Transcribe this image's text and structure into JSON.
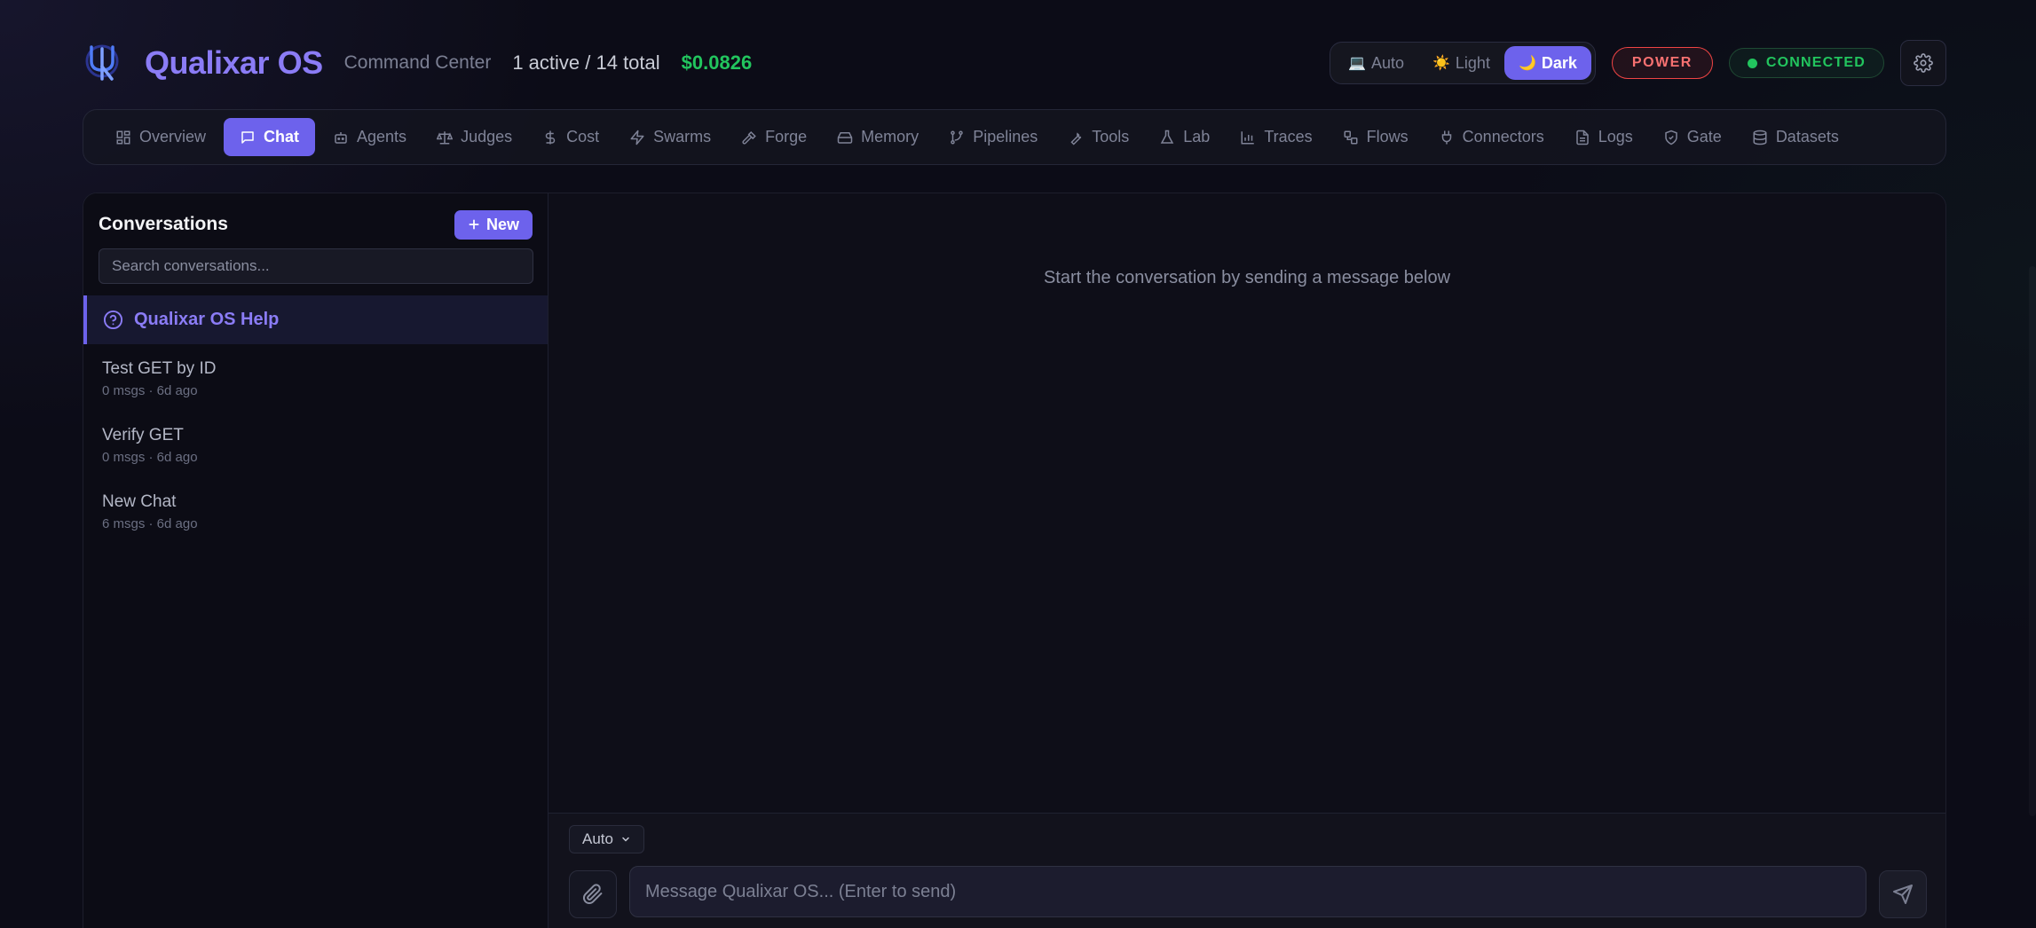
{
  "header": {
    "app_title": "Qualixar OS",
    "subtitle": "Command Center",
    "agent_count": "1 active / 14 total",
    "cost": "$0.0826",
    "theme": {
      "options": [
        {
          "emoji": "💻",
          "label": "Auto"
        },
        {
          "emoji": "☀️",
          "label": "Light"
        },
        {
          "emoji": "🌙",
          "label": "Dark"
        }
      ],
      "selected": "Dark"
    },
    "power_badge": "POWER",
    "connection_badge": "CONNECTED"
  },
  "nav": {
    "active": "Chat",
    "items": [
      {
        "label": "Overview",
        "icon": "grid-icon"
      },
      {
        "label": "Chat",
        "icon": "chat-bubble-icon"
      },
      {
        "label": "Agents",
        "icon": "bot-icon"
      },
      {
        "label": "Judges",
        "icon": "scale-icon"
      },
      {
        "label": "Cost",
        "icon": "dollar-icon"
      },
      {
        "label": "Swarms",
        "icon": "bolt-icon"
      },
      {
        "label": "Forge",
        "icon": "hammer-icon"
      },
      {
        "label": "Memory",
        "icon": "hard-drive-icon"
      },
      {
        "label": "Pipelines",
        "icon": "git-branch-icon"
      },
      {
        "label": "Tools",
        "icon": "wrench-icon"
      },
      {
        "label": "Lab",
        "icon": "flask-icon"
      },
      {
        "label": "Traces",
        "icon": "bar-chart-icon"
      },
      {
        "label": "Flows",
        "icon": "workflow-icon"
      },
      {
        "label": "Connectors",
        "icon": "plug-icon"
      },
      {
        "label": "Logs",
        "icon": "file-text-icon"
      },
      {
        "label": "Gate",
        "icon": "shield-check-icon"
      },
      {
        "label": "Datasets",
        "icon": "database-icon"
      }
    ]
  },
  "sidebar": {
    "title": "Conversations",
    "new_button": "New",
    "search_placeholder": "Search conversations...",
    "active_conversation": "Qualixar OS Help",
    "conversations": [
      {
        "name": "Test GET by ID",
        "meta": "0 msgs · 6d ago"
      },
      {
        "name": "Verify GET",
        "meta": "0 msgs · 6d ago"
      },
      {
        "name": "New Chat",
        "meta": "6 msgs · 6d ago"
      }
    ]
  },
  "chat": {
    "empty_state": "Start the conversation by sending a message below",
    "model_select": "Auto",
    "input_placeholder": "Message Qualixar OS... (Enter to send)"
  },
  "colors": {
    "accent": "#6d62ec",
    "title": "#8b7cf6",
    "cost_green": "#22c55e",
    "power_red": "#ef4444",
    "background": "#0c0c17"
  }
}
